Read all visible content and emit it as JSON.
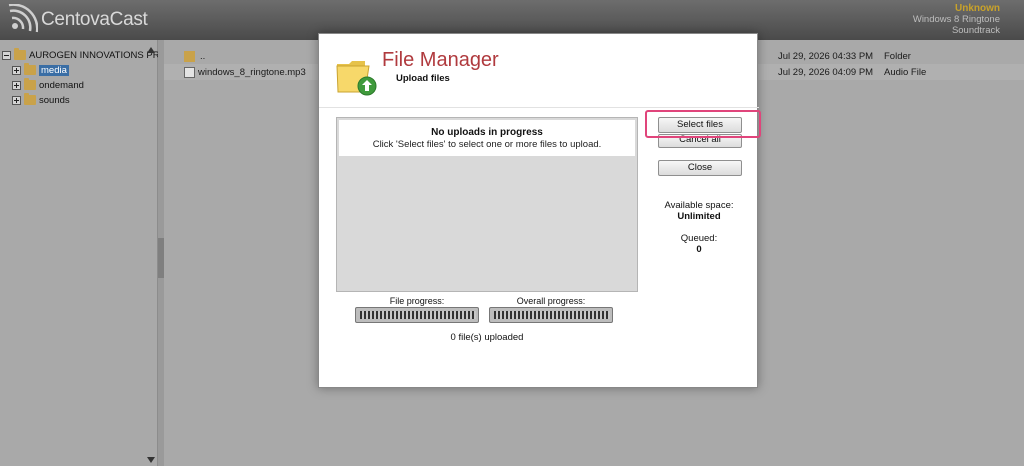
{
  "app": {
    "name": "CentovaCast"
  },
  "now_playing": {
    "title": "Unknown",
    "line1": "Windows 8 Ringtone",
    "line2": "Soundtrack"
  },
  "tree": {
    "root": "AUROGEN INNOVATIONS PR",
    "items": [
      {
        "label": "media",
        "selected": true
      },
      {
        "label": "ondemand",
        "selected": false
      },
      {
        "label": "sounds",
        "selected": false
      }
    ]
  },
  "files": {
    "rows": [
      {
        "name": "..",
        "date": "Jul 29, 2026 04:33 PM",
        "type": "Folder",
        "icon": "folder-icon"
      },
      {
        "name": "windows_8_ringtone.mp3",
        "date": "Jul 29, 2026 04:09 PM",
        "type": "Audio File",
        "icon": "audio-file-icon"
      }
    ]
  },
  "modal": {
    "title": "File Manager",
    "subtitle": "Upload files",
    "queue_heading": "No uploads in progress",
    "queue_text": "Click 'Select files' to select one or more files to upload.",
    "buttons": {
      "select": "Select files",
      "cancel": "Cancel all",
      "close": "Close"
    },
    "available_label": "Available space:",
    "available_value": "Unlimited",
    "queued_label": "Queued:",
    "queued_value": "0",
    "file_progress_label": "File progress:",
    "overall_progress_label": "Overall progress:",
    "file_progress": 0,
    "overall_progress": 0,
    "uploaded_text": "0 file(s) uploaded"
  },
  "colors": {
    "title_red": "#b03a3e",
    "highlight": "#e0457b",
    "now_playing_gold": "#c8a22a"
  }
}
